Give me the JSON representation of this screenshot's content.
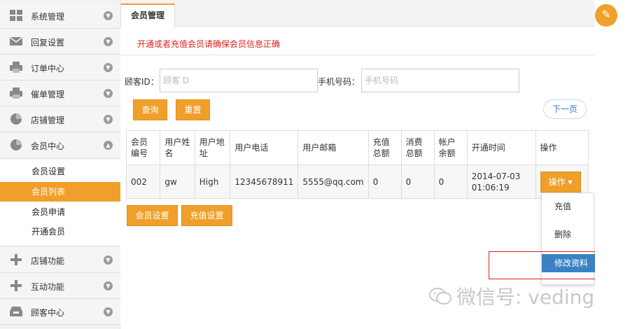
{
  "sidebar": {
    "items": [
      {
        "label": "系统管理",
        "icon": "grid-icon"
      },
      {
        "label": "回复设置",
        "icon": "envelope-icon"
      },
      {
        "label": "订单中心",
        "icon": "printer-icon"
      },
      {
        "label": "催单管理",
        "icon": "printer-icon"
      },
      {
        "label": "店铺管理",
        "icon": "pie-chart-icon"
      },
      {
        "label": "会员中心",
        "icon": "pie-chart-icon"
      },
      {
        "label": "店铺功能",
        "icon": "plus-icon"
      },
      {
        "label": "互动功能",
        "icon": "plus-icon"
      },
      {
        "label": "顾客中心",
        "icon": "inbox-icon"
      }
    ],
    "subitems": [
      {
        "label": "会员设置"
      },
      {
        "label": "会员列表"
      },
      {
        "label": "会员申请"
      },
      {
        "label": "开通会员"
      }
    ]
  },
  "tab": {
    "label": "会员管理"
  },
  "notice": "开通或者充值会员请确保会员信息正确",
  "search": {
    "customer_id_label": "顾客ID：",
    "customer_id_placeholder": "顾客 D",
    "phone_label": "手机号码：",
    "phone_placeholder": "手机号码",
    "query_label": "查询",
    "reset_label": "重置",
    "next_page_label": "下一页"
  },
  "table": {
    "headers": [
      "会员编号",
      "用户姓名",
      "用户地址",
      "用户电话",
      "用户邮箱",
      "充值总额",
      "消费总额",
      "帐户余额",
      "开通时间",
      "操作"
    ],
    "rows": [
      {
        "id": "002",
        "name": "gw",
        "address": "High",
        "phone": "12345678911",
        "email": "5555@qq.com",
        "recharge": "0",
        "spent": "0",
        "balance": "0",
        "opened": "2014-07-03 01:06:19",
        "action": "操作"
      }
    ]
  },
  "dropdown": {
    "items": [
      "充值",
      "删除",
      "修改资料"
    ]
  },
  "bottom_buttons": {
    "member_settings": "会员设置",
    "recharge_settings": "充值设置"
  },
  "watermark": "微信号: veding",
  "colors": {
    "accent": "#f0a02a",
    "notice_red": "#d9231d",
    "highlight_blue": "#3a82c4"
  }
}
